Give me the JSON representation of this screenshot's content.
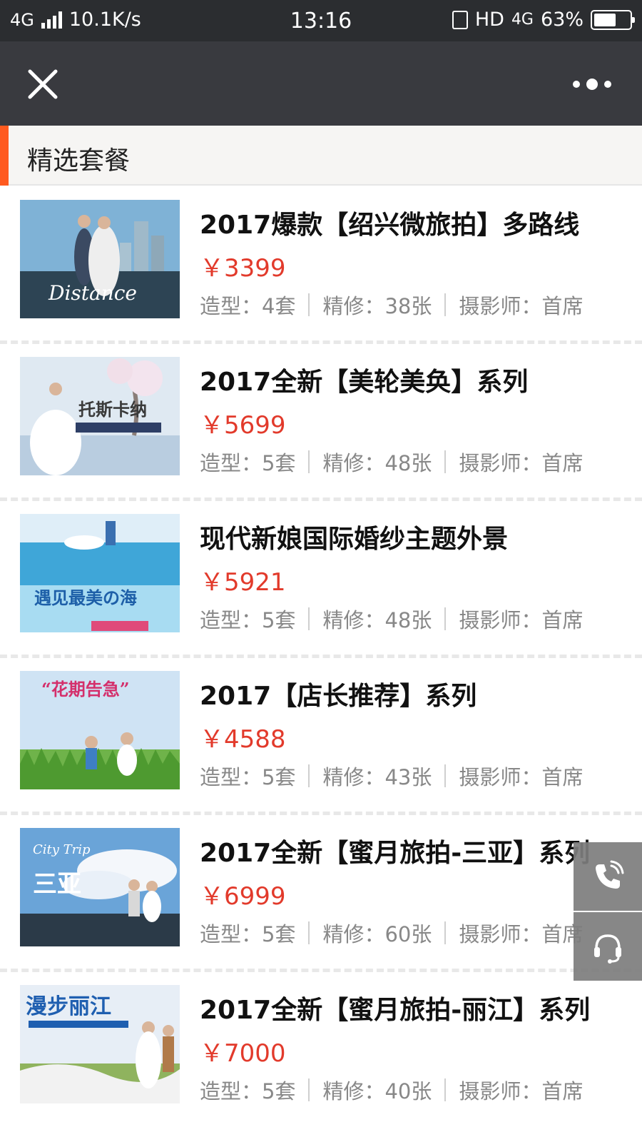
{
  "status_bar": {
    "network": "4G",
    "speed": "10.1K/s",
    "time": "13:16",
    "hd": "HD",
    "network2": "4G",
    "battery_text": "63%",
    "battery_level": 0.63
  },
  "nav": {
    "close_icon": "close-icon",
    "more_icon": "more-icon"
  },
  "section": {
    "title": "精选套餐",
    "accent_color": "#ff5a1f"
  },
  "packages": [
    {
      "name": "2017爆款【绍兴微旅拍】多路线",
      "price": "￥3399",
      "styles": "造型：4套",
      "retouch": "精修：38张",
      "photographer": "摄影师：首席",
      "thumb_text": "Distance"
    },
    {
      "name": "2017全新【美轮美奂】系列",
      "price": "￥5699",
      "styles": "造型：5套",
      "retouch": "精修：48张",
      "photographer": "摄影师：首席",
      "thumb_text": "托斯卡纳"
    },
    {
      "name": "现代新娘国际婚纱主题外景",
      "price": "￥5921",
      "styles": "造型：5套",
      "retouch": "精修：48张",
      "photographer": "摄影师：首席",
      "thumb_text": "遇见最美の海"
    },
    {
      "name": "2017【店长推荐】系列",
      "price": "￥4588",
      "styles": "造型：5套",
      "retouch": "精修：43张",
      "photographer": "摄影师：首席",
      "thumb_text": "“花期告急”"
    },
    {
      "name": "2017全新【蜜月旅拍-三亚】系列",
      "price": "￥6999",
      "styles": "造型：5套",
      "retouch": "精修：60张",
      "photographer": "摄影师：首席",
      "thumb_text": "三亚"
    },
    {
      "name": "2017全新【蜜月旅拍-丽江】系列",
      "price": "￥7000",
      "styles": "造型：5套",
      "retouch": "精修：40张",
      "photographer": "摄影师：首席",
      "thumb_text": "漫步丽江"
    }
  ],
  "floating": {
    "phone_icon": "phone-icon",
    "support_icon": "headset-icon"
  },
  "colors": {
    "price": "#e23a2b",
    "navbar": "#393a3f",
    "statusbar": "#2b2d30"
  }
}
